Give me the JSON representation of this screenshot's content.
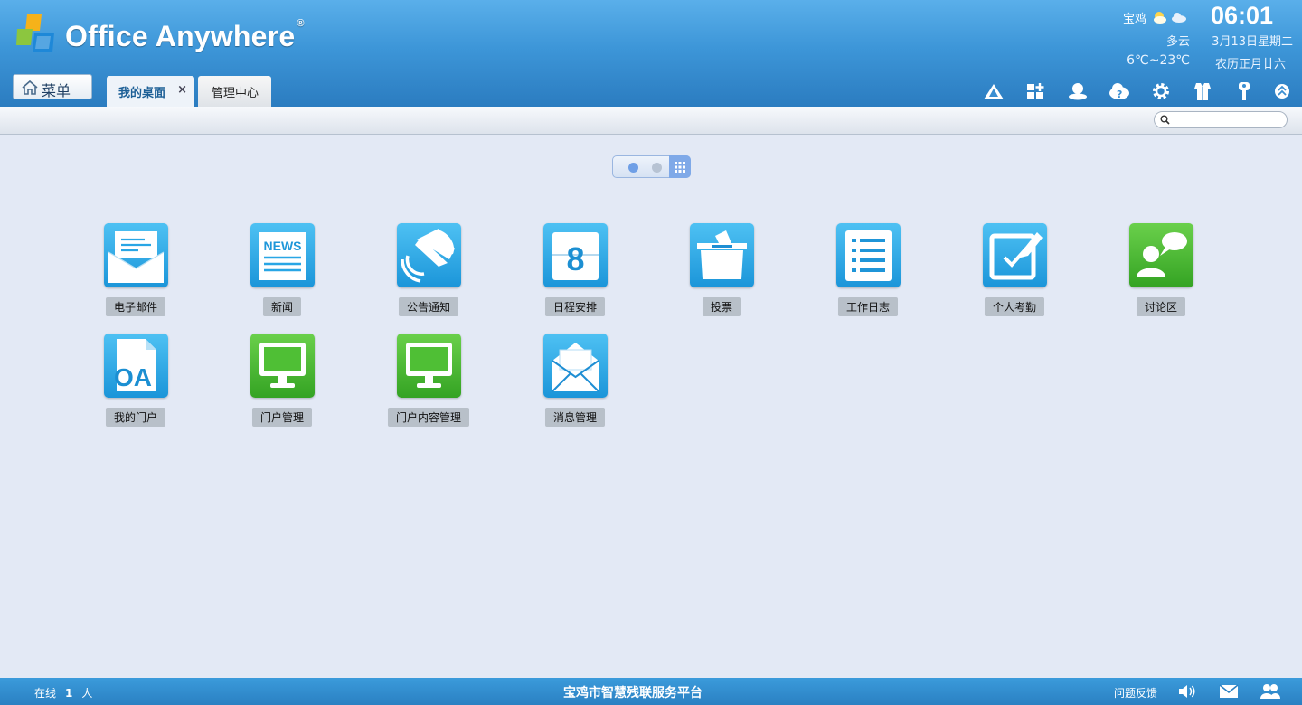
{
  "app": {
    "logo_text": "Office Anywhere",
    "logo_mark": "®"
  },
  "header": {
    "weather_city": "宝鸡",
    "weather_desc": "多云",
    "temperature": "6℃~23℃",
    "clock": "06:01",
    "date": "3月13日星期二",
    "lunar_date": "农历正月廿六",
    "weather_icons": [
      "sun-cloud-icon",
      "cloud-icon"
    ]
  },
  "menu_button": {
    "label": "菜单",
    "icon": "home-icon"
  },
  "tabs": [
    {
      "label": "我的桌面",
      "active": true,
      "close": "×"
    },
    {
      "label": "管理中心",
      "active": false
    }
  ],
  "toolbar_icons": [
    "user-alert-icon",
    "add-widget-icon",
    "user-status-icon",
    "help-icon",
    "settings-icon",
    "theme-icon",
    "key-icon",
    "collapse-icon"
  ],
  "search": {
    "placeholder": "",
    "value": ""
  },
  "pager": {
    "pages": 2,
    "current": 1
  },
  "apps": [
    {
      "label": "电子邮件",
      "icon": "email-icon",
      "color": "blue"
    },
    {
      "label": "新闻",
      "icon": "news-icon",
      "color": "blue",
      "icon_text": "NEWS"
    },
    {
      "label": "公告通知",
      "icon": "announcement-bell-icon",
      "color": "blue"
    },
    {
      "label": "日程安排",
      "icon": "calendar-icon",
      "color": "blue",
      "icon_text": "8"
    },
    {
      "label": "投票",
      "icon": "ballot-box-icon",
      "color": "blue"
    },
    {
      "label": "工作日志",
      "icon": "worklog-list-icon",
      "color": "blue"
    },
    {
      "label": "个人考勤",
      "icon": "attendance-edit-icon",
      "color": "blue"
    },
    {
      "label": "讨论区",
      "icon": "discussion-icon",
      "color": "green"
    },
    {
      "label": "我的门户",
      "icon": "oa-document-icon",
      "color": "blue",
      "icon_text": "OA"
    },
    {
      "label": "门户管理",
      "icon": "monitor-icon",
      "color": "green"
    },
    {
      "label": "门户内容管理",
      "icon": "monitor-icon",
      "color": "green"
    },
    {
      "label": "消息管理",
      "icon": "message-envelope-icon",
      "color": "blue"
    }
  ],
  "footer": {
    "online_prefix": "在线",
    "online_count": "1",
    "online_suffix": "人",
    "platform_name": "宝鸡市智慧残联服务平台",
    "feedback": "问题反馈",
    "icons": [
      "speaker-icon",
      "mail-icon",
      "contacts-icon"
    ]
  },
  "colors": {
    "header": "#3d96d8",
    "body": "#e3e9f5",
    "tile_blue": "#29a6e5",
    "tile_green": "#46b530",
    "footer": "#2f8ccd"
  }
}
